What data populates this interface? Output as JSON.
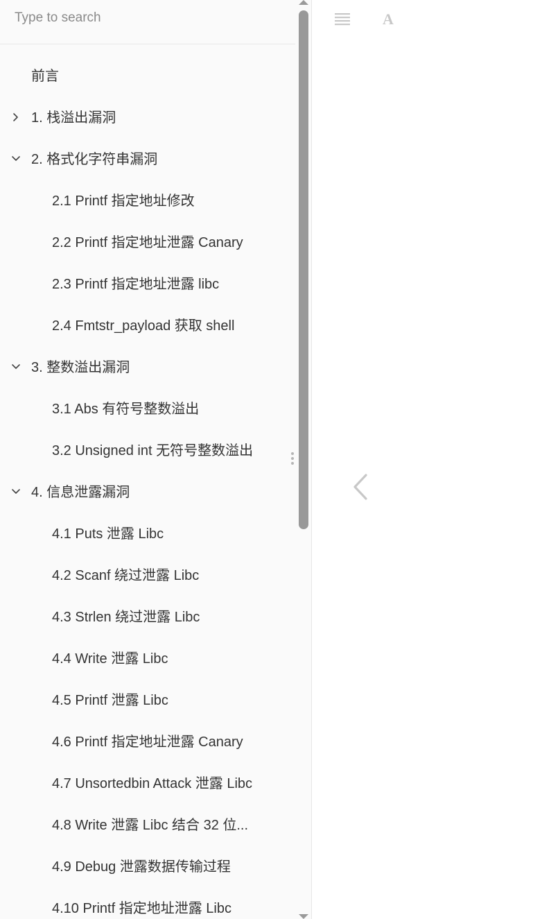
{
  "search": {
    "placeholder": "Type to search",
    "value": ""
  },
  "toc": [
    {
      "label": "前言",
      "level": 1,
      "state": "none"
    },
    {
      "label": "1. 栈溢出漏洞",
      "level": 1,
      "state": "collapsed"
    },
    {
      "label": "2. 格式化字符串漏洞",
      "level": 1,
      "state": "expanded"
    },
    {
      "label": "2.1 Printf 指定地址修改",
      "level": 2,
      "state": "none"
    },
    {
      "label": "2.2 Printf 指定地址泄露 Canary",
      "level": 2,
      "state": "none"
    },
    {
      "label": "2.3 Printf 指定地址泄露 libc",
      "level": 2,
      "state": "none"
    },
    {
      "label": "2.4 Fmtstr_payload 获取 shell",
      "level": 2,
      "state": "none"
    },
    {
      "label": "3. 整数溢出漏洞",
      "level": 1,
      "state": "expanded"
    },
    {
      "label": "3.1 Abs 有符号整数溢出",
      "level": 2,
      "state": "none"
    },
    {
      "label": "3.2 Unsigned int 无符号整数溢出",
      "level": 2,
      "state": "none"
    },
    {
      "label": "4. 信息泄露漏洞",
      "level": 1,
      "state": "expanded"
    },
    {
      "label": "4.1 Puts 泄露 Libc",
      "level": 2,
      "state": "none"
    },
    {
      "label": "4.2 Scanf 绕过泄露 Libc",
      "level": 2,
      "state": "none"
    },
    {
      "label": "4.3 Strlen 绕过泄露 Libc",
      "level": 2,
      "state": "none"
    },
    {
      "label": "4.4 Write 泄露 Libc",
      "level": 2,
      "state": "none"
    },
    {
      "label": "4.5 Printf 泄露 Libc",
      "level": 2,
      "state": "none"
    },
    {
      "label": "4.6 Printf 指定地址泄露 Canary",
      "level": 2,
      "state": "none"
    },
    {
      "label": "4.7 Unsortedbin Attack 泄露 Libc",
      "level": 2,
      "state": "none"
    },
    {
      "label": "4.8 Write 泄露 Libc 结合 32 位...",
      "level": 2,
      "state": "none"
    },
    {
      "label": "4.9 Debug 泄露数据传输过程",
      "level": 2,
      "state": "none"
    },
    {
      "label": "4.10 Printf 指定地址泄露 Libc",
      "level": 2,
      "state": "none"
    }
  ],
  "toolbar": {
    "toc_icon": "list-icon",
    "font_icon": "font-settings-icon",
    "font_glyph": "A"
  },
  "nav": {
    "prev_icon": "chevron-left-icon"
  },
  "colors": {
    "sidebar_bg": "#fafafa",
    "text": "#333333",
    "muted_icon": "#c8c8c8",
    "scrollbar_thumb": "#999999"
  }
}
